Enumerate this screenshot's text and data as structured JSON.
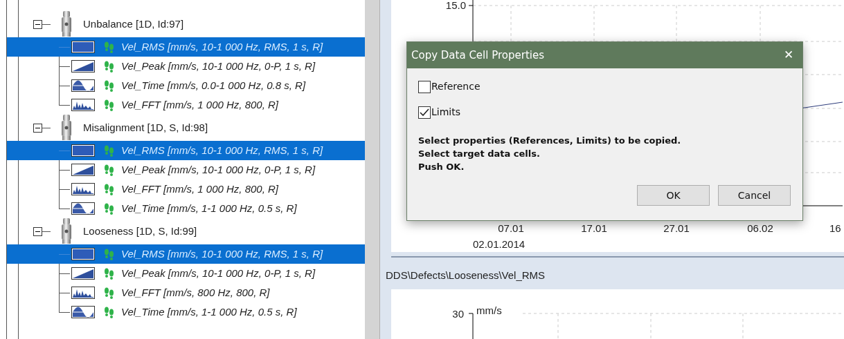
{
  "tree": {
    "groups": [
      {
        "label": "Unbalance [1D, Id:97]",
        "expanded": true,
        "children": [
          {
            "kind": "rms",
            "label": "Vel_RMS [mm/s, 10-1 000 Hz, RMS, 1 s, R]",
            "selected": true
          },
          {
            "kind": "peak",
            "label": "Vel_Peak [mm/s, 10-1 000 Hz, 0-P, 1 s, R]",
            "selected": false
          },
          {
            "kind": "time",
            "label": "Vel_Time [mm/s, 0.0-1 000 Hz, 0.8 s, R]",
            "selected": false
          },
          {
            "kind": "fft",
            "label": "Vel_FFT [mm/s, 1 000 Hz, 800, R]",
            "selected": false
          }
        ]
      },
      {
        "label": "Misalignment [1D, S, Id:98]",
        "expanded": true,
        "children": [
          {
            "kind": "rms",
            "label": "Vel_RMS [mm/s, 10-1 000 Hz, RMS, 1 s, R]",
            "selected": true
          },
          {
            "kind": "peak",
            "label": "Vel_Peak [mm/s, 10-1 000 Hz, 0-P, 1 s, R]",
            "selected": false
          },
          {
            "kind": "fft",
            "label": "Vel_FFT [mm/s, 1 000 Hz, 800, R]",
            "selected": false
          },
          {
            "kind": "time",
            "label": "Vel_Time [mm/s, 1-1 000 Hz, 0.5 s, R]",
            "selected": false
          }
        ]
      },
      {
        "label": "Looseness [1D, S, Id:99]",
        "expanded": true,
        "children": [
          {
            "kind": "rms",
            "label": "Vel_RMS [mm/s, 10-1 000 Hz, RMS, 1 s, R]",
            "selected": true
          },
          {
            "kind": "peak",
            "label": "Vel_Peak [mm/s, 10-1 000 Hz, 0-P, 1 s, R]",
            "selected": false
          },
          {
            "kind": "fft",
            "label": "Vel_FFT [mm/s, 800 Hz, 800, R]",
            "selected": false
          },
          {
            "kind": "time",
            "label": "Vel_Time [mm/s, 1-1 000 Hz, 0.5 s, R]",
            "selected": false
          }
        ]
      }
    ]
  },
  "top_chart": {
    "y_tick": "15.0",
    "x_ticks": [
      "07.01",
      "17.01",
      "27.01",
      "06.02",
      "16"
    ],
    "date": "02.01.2014"
  },
  "bottom_panel": {
    "title": "DDS\\Defects\\Looseness\\Vel_RMS",
    "y_tick": "30",
    "unit": "mm/s"
  },
  "dialog": {
    "title": "Copy Data Cell Properties",
    "close": "✕",
    "options": [
      {
        "label": "Reference",
        "checked": false
      },
      {
        "label": "Limits",
        "checked": true
      }
    ],
    "message": [
      "Select properties (References, Limits) to be copied.",
      "Select target data cells.",
      "Push OK."
    ],
    "buttons": [
      "OK",
      "Cancel"
    ]
  }
}
